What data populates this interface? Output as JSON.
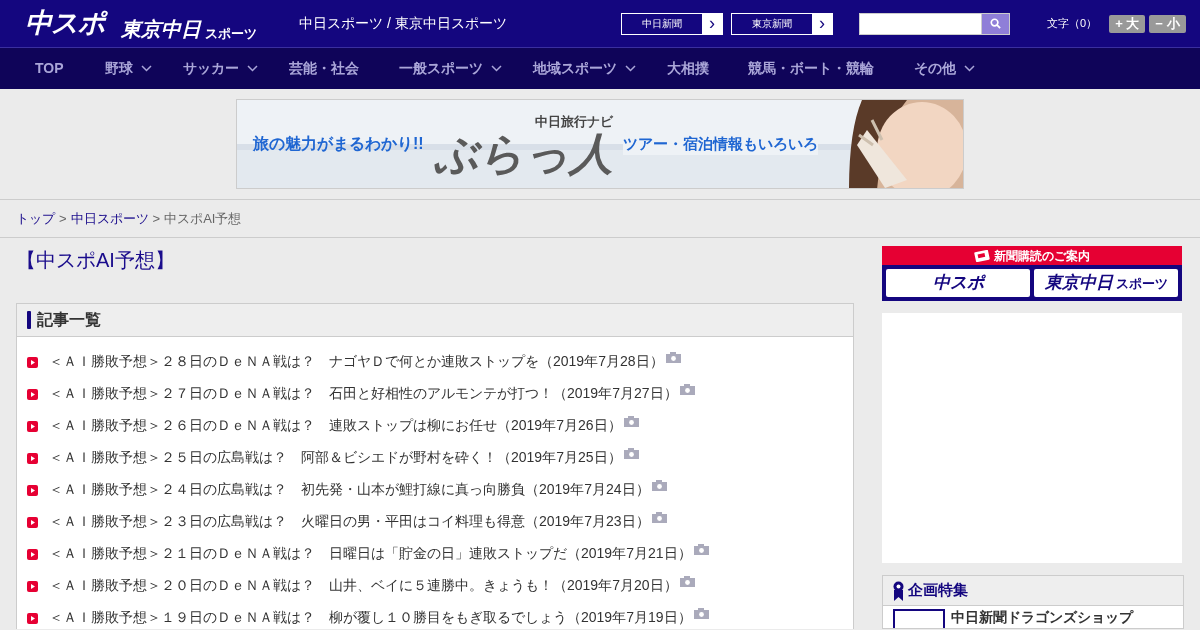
{
  "header": {
    "logo_main": "中スポ",
    "logo_sub": "東京中日",
    "logo_sub_small": "スポーツ",
    "tagline": "中日スポーツ / 東京中日スポーツ",
    "paper_links": [
      {
        "label": "中日新聞",
        "arrow": "›"
      },
      {
        "label": "東京新聞",
        "arrow": "›"
      }
    ],
    "font_size": {
      "label": "文字（0）",
      "buttons": [
        {
          "sign": "+",
          "label": "大"
        },
        {
          "sign": "−",
          "label": "小"
        }
      ]
    }
  },
  "nav": [
    {
      "label": "TOP",
      "has_menu": false
    },
    {
      "label": "野球",
      "has_menu": true
    },
    {
      "label": "サッカー",
      "has_menu": true
    },
    {
      "label": "芸能・社会",
      "has_menu": false
    },
    {
      "label": "一般スポーツ",
      "has_menu": true
    },
    {
      "label": "地域スポーツ",
      "has_menu": true
    },
    {
      "label": "大相撲",
      "has_menu": false
    },
    {
      "label": "競馬・ボート・競輪",
      "has_menu": false
    },
    {
      "label": "その他",
      "has_menu": true
    }
  ],
  "banner": {
    "kind": "picture",
    "lead": "旅の魅力がまるわかり!!",
    "brand_small": "中日旅行ナビ",
    "brand": "ぶらっ人",
    "tail": "ツアー・宿泊情報もいろいろ"
  },
  "breadcrumb": [
    {
      "label": "トップ",
      "link": true
    },
    {
      "label": "中日スポーツ",
      "link": true
    },
    {
      "label": "中スポAI予想",
      "link": false
    }
  ],
  "breadcrumb_separator": ">",
  "page_title": "【中スポAI予想】",
  "article_list": {
    "heading": "記事一覧",
    "items": [
      {
        "title": "＜ＡＩ勝敗予想＞２８日のＤｅＮＡ戦は？　ナゴヤＤで何とか連敗ストップを",
        "date": "（2019年7月28日）",
        "has_photo": true
      },
      {
        "title": "＜ＡＩ勝敗予想＞２７日のＤｅＮＡ戦は？　石田と好相性のアルモンテが打つ！",
        "date": "（2019年7月27日）",
        "has_photo": true
      },
      {
        "title": "＜ＡＩ勝敗予想＞２６日のＤｅＮＡ戦は？　連敗ストップは柳にお任せ",
        "date": "（2019年7月26日）",
        "has_photo": true
      },
      {
        "title": "＜ＡＩ勝敗予想＞２５日の広島戦は？　阿部＆ビシエドが野村を砕く！",
        "date": "（2019年7月25日）",
        "has_photo": true
      },
      {
        "title": "＜ＡＩ勝敗予想＞２４日の広島戦は？　初先発・山本が鯉打線に真っ向勝負",
        "date": "（2019年7月24日）",
        "has_photo": true
      },
      {
        "title": "＜ＡＩ勝敗予想＞２３日の広島戦は？　火曜日の男・平田はコイ料理も得意",
        "date": "（2019年7月23日）",
        "has_photo": true
      },
      {
        "title": "＜ＡＩ勝敗予想＞２１日のＤｅＮＡ戦は？　日曜日は「貯金の日」連敗ストップだ",
        "date": "（2019年7月21日）",
        "has_photo": true
      },
      {
        "title": "＜ＡＩ勝敗予想＞２０日のＤｅＮＡ戦は？　山井、ベイに５連勝中。きょうも！",
        "date": "（2019年7月20日）",
        "has_photo": true
      },
      {
        "title": "＜ＡＩ勝敗予想＞１９日のＤｅＮＡ戦は？　柳が覆し１０勝目をもぎ取るでしょう",
        "date": "（2019年7月19日）",
        "has_photo": true
      }
    ]
  },
  "sidebar": {
    "subscribe": {
      "title": "新聞購読のご案内",
      "buttons": [
        {
          "label": "中スポ"
        },
        {
          "label": "東京中日",
          "small": "スポーツ"
        }
      ]
    },
    "feature": {
      "heading": "企画特集",
      "items": [
        {
          "label": "中日新聞ドラゴンズショップ"
        }
      ]
    }
  }
}
